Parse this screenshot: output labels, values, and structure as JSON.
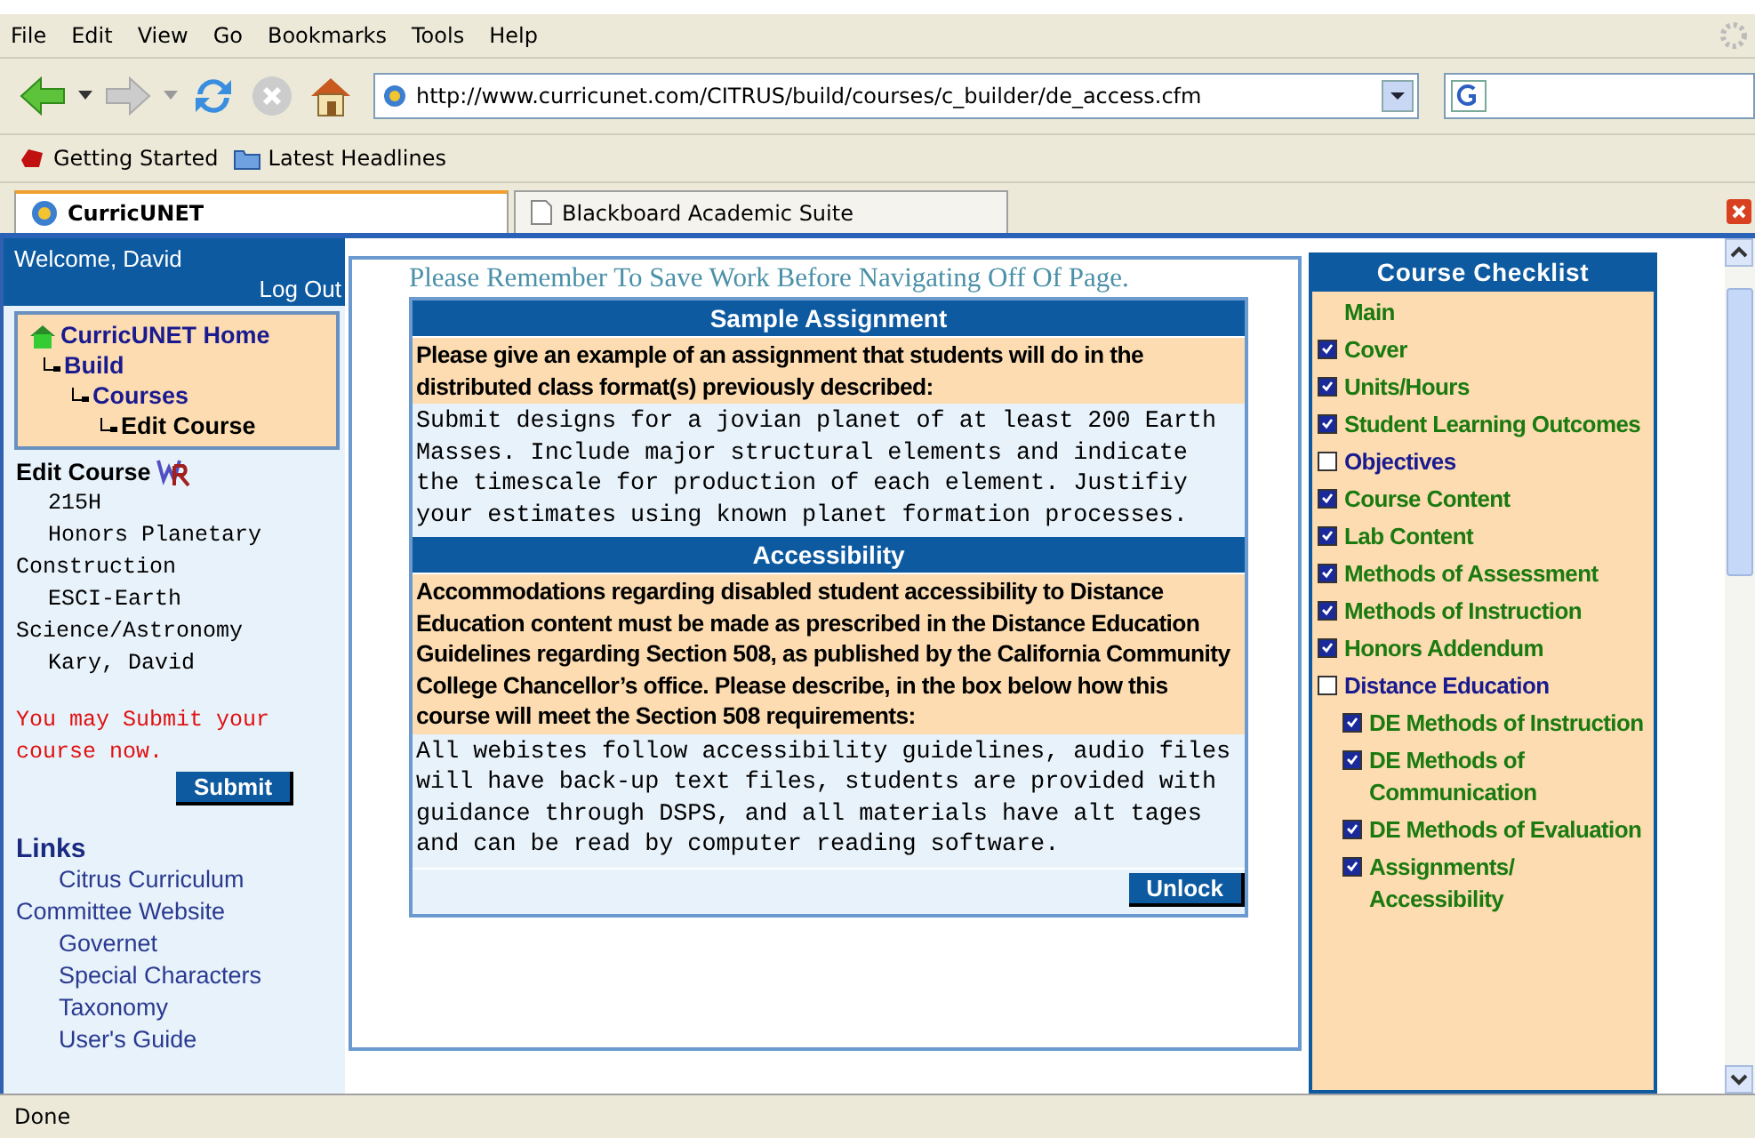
{
  "menu": [
    "File",
    "Edit",
    "View",
    "Go",
    "Bookmarks",
    "Tools",
    "Help"
  ],
  "address": "http://www.curricunet.com/CITRUS/build/courses/c_builder/de_access.cfm",
  "bookmarks": [
    "Getting Started",
    "Latest Headlines"
  ],
  "tabs": [
    {
      "label": "CurricUNET",
      "selected": true
    },
    {
      "label": "Blackboard Academic Suite",
      "selected": false
    }
  ],
  "sidebar": {
    "welcome": "Welcome, David",
    "logout": "Log Out",
    "breadcrumb": [
      {
        "label": "CurricUNET Home",
        "current": false
      },
      {
        "label": "Build",
        "current": false
      },
      {
        "label": "Courses",
        "current": false
      },
      {
        "label": "Edit Course",
        "current": true
      }
    ],
    "edit_title": "Edit Course",
    "course_lines": [
      "215H",
      "Honors Planetary Construction",
      "ESCI-Earth Science/Astronomy",
      "Kary, David"
    ],
    "submit_note": "You may Submit your course now.",
    "submit_button": "Submit",
    "links_title": "Links",
    "links": [
      "Citrus Curriculum Committee Website",
      "Governet",
      "Special Characters",
      "Taxonomy",
      "User's Guide"
    ]
  },
  "notice": "Please Remember To Save Work Before Navigating Off Of Page.",
  "sections": [
    {
      "title": "Sample Assignment",
      "prompt": "Please give an example of an assignment that students will do in the distributed class format(s) previously described:",
      "answer": "Submit designs for a jovian planet of at least 200 Earth Masses. Include major structural elements and indicate the timescale for production of each element. Justifiy your estimates using known planet formation processes."
    },
    {
      "title": "Accessibility",
      "prompt": "Accommodations regarding disabled student accessibility to Distance Education content must be made as prescribed in the Distance Education Guidelines regarding Section 508, as published by the California Community College Chancellor’s office. Please describe, in the box below how this course will meet the Section 508 requirements:",
      "answer": "All webistes follow accessibility guidelines, audio files will have back-up text files, students are provided with guidance through DSPS, and all materials have alt tages and can be read by computer reading software."
    }
  ],
  "unlock_button": "Unlock",
  "checklist": {
    "title": "Course Checklist",
    "items": [
      {
        "label": "Main",
        "kind": "plain"
      },
      {
        "label": "Cover",
        "kind": "check",
        "checked": true
      },
      {
        "label": "Units/Hours",
        "kind": "check",
        "checked": true
      },
      {
        "label": "Student Learning Outcomes",
        "kind": "check",
        "checked": true
      },
      {
        "label": "Objectives",
        "kind": "check",
        "checked": false
      },
      {
        "label": "Course Content",
        "kind": "check",
        "checked": true
      },
      {
        "label": "Lab Content",
        "kind": "check",
        "checked": true
      },
      {
        "label": "Methods of Assessment",
        "kind": "check",
        "checked": true
      },
      {
        "label": "Methods of Instruction",
        "kind": "check",
        "checked": true
      },
      {
        "label": "Honors Addendum",
        "kind": "check",
        "checked": true
      },
      {
        "label": "Distance Education",
        "kind": "check",
        "checked": false,
        "children": [
          {
            "label": "DE Methods of Instruction",
            "kind": "check",
            "checked": true
          },
          {
            "label": "DE Methods of Communication",
            "kind": "check",
            "checked": true
          },
          {
            "label": "DE Methods of Evaluation",
            "kind": "check",
            "checked": true
          },
          {
            "label": "Assignments/ Accessibility",
            "kind": "check",
            "checked": true
          }
        ]
      }
    ]
  },
  "status_bar": "Done"
}
